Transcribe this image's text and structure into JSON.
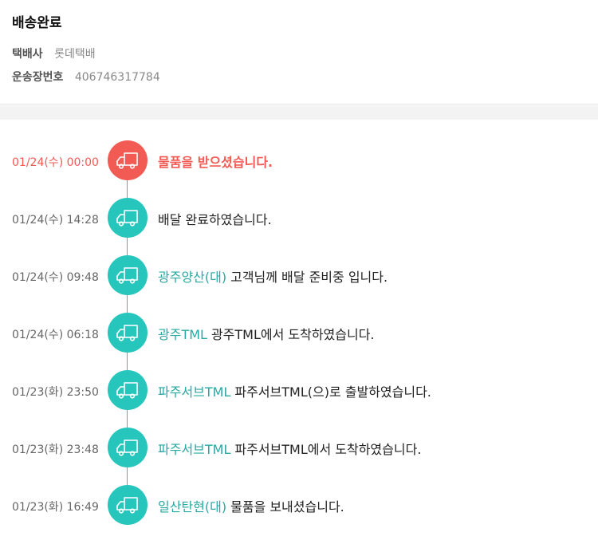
{
  "header": {
    "status": "배송완료",
    "carrier_label": "택배사",
    "carrier": "롯데택배",
    "tracking_label": "운송장번호",
    "tracking_number": "406746317784"
  },
  "colors": {
    "accent_teal": "#27c6bd",
    "location_text": "#27a9a3",
    "current_red": "#f25a54"
  },
  "events": [
    {
      "time": "01/24(수) 00:00",
      "location": "",
      "message": "물품을 받으셨습니다.",
      "icon": "truck-icon",
      "current": true
    },
    {
      "time": "01/24(수) 14:28",
      "location": "",
      "message": "배달 완료하였습니다.",
      "icon": "truck-icon"
    },
    {
      "time": "01/24(수) 09:48",
      "location": "광주양산(대)",
      "message": "고객님께 배달 준비중 입니다.",
      "icon": "truck-icon"
    },
    {
      "time": "01/24(수) 06:18",
      "location": "광주TML",
      "message": "광주TML에서 도착하였습니다.",
      "icon": "truck-icon"
    },
    {
      "time": "01/23(화) 23:50",
      "location": "파주서브TML",
      "message": "파주서브TML(으)로 출발하였습니다.",
      "icon": "truck-icon"
    },
    {
      "time": "01/23(화) 23:48",
      "location": "파주서브TML",
      "message": "파주서브TML에서 도착하였습니다.",
      "icon": "truck-icon"
    },
    {
      "time": "01/23(화) 16:49",
      "location": "일산탄현(대)",
      "message": "물품을 보내셨습니다.",
      "icon": "truck-icon"
    }
  ]
}
